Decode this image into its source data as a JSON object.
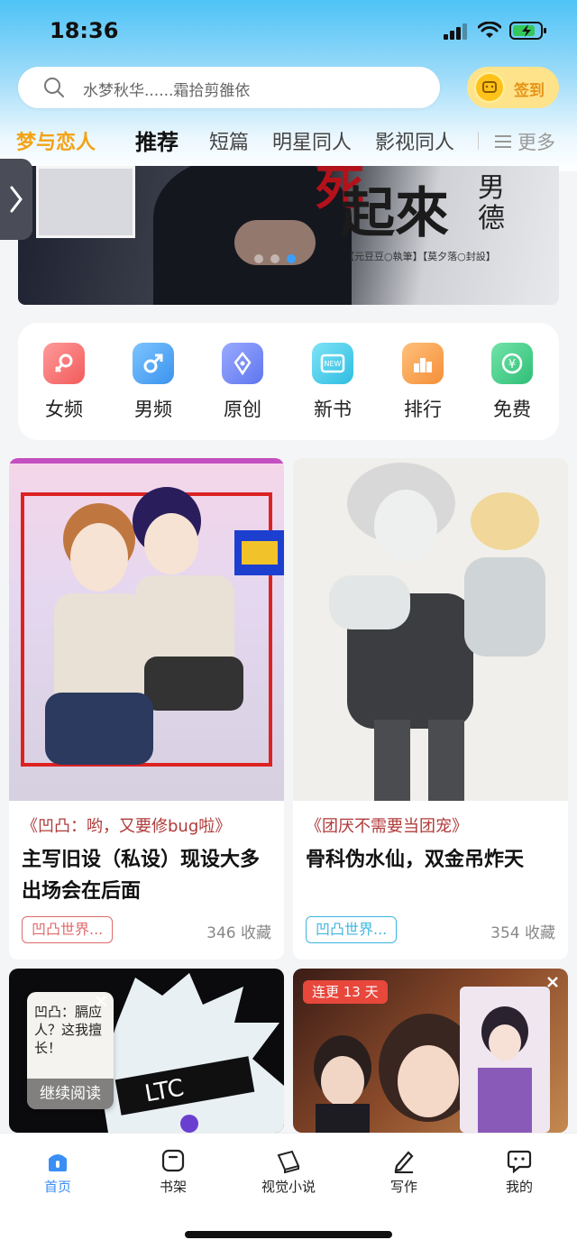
{
  "status_bar": {
    "time": "18:36"
  },
  "search": {
    "text": "水梦秋华......霜拾剪雒依"
  },
  "checkin": {
    "label": "签到"
  },
  "category_tabs": {
    "brand": "梦与恋人",
    "tabs": [
      "推荐",
      "短篇",
      "明星同人",
      "影视同人"
    ],
    "active": "推荐",
    "more": "更多"
  },
  "banner": {
    "title": "起來",
    "red_text": "死",
    "side_text": "男德",
    "credits": "【元豆豆○執筆】【莫夕落○封設】"
  },
  "quick_entries": [
    {
      "label": "女频",
      "icon": "female-icon",
      "color": "#f36b6b"
    },
    {
      "label": "男频",
      "icon": "male-icon",
      "color": "#4aa4f2"
    },
    {
      "label": "原创",
      "icon": "pen-icon",
      "color": "#6d86f0"
    },
    {
      "label": "新书",
      "icon": "new-book-icon",
      "color": "#3fc6e6"
    },
    {
      "label": "排行",
      "icon": "ranking-icon",
      "color": "#f7a24a"
    },
    {
      "label": "免费",
      "icon": "free-icon",
      "color": "#3fcc8a"
    }
  ],
  "books": [
    {
      "tag": "《凹凸：哟，又要修bug啦》",
      "title": "主写旧设（私设）现设大多出场会在后面",
      "badge": "凹凸世界...",
      "collect": "346 收藏",
      "tag_color": "#b03a3a",
      "badge_color": "#e06a6a"
    },
    {
      "tag": "《团厌不需要当团宠》",
      "title": "骨科伪水仙，双金吊炸天",
      "badge": "凹凸世界...",
      "collect": "354 收藏",
      "tag_color": "#b03a3a",
      "badge_color": "#3fb6e0"
    }
  ],
  "continue_reading": {
    "label": "继续阅读",
    "cover_text": "凹凸：膈应人？这我擅长！"
  },
  "update_badge": "连更 13 天",
  "tab_bar": {
    "items": [
      {
        "label": "首页",
        "icon": "home-icon"
      },
      {
        "label": "书架",
        "icon": "bookshelf-icon"
      },
      {
        "label": "视觉小说",
        "icon": "visual-novel-icon"
      },
      {
        "label": "写作",
        "icon": "write-icon"
      },
      {
        "label": "我的",
        "icon": "profile-icon"
      }
    ],
    "active": "首页",
    "active_color": "#3a8ef6"
  }
}
